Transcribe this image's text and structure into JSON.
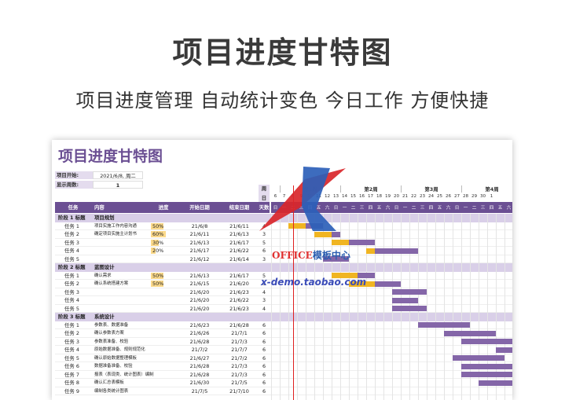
{
  "banner": {
    "title": "项目进度甘特图",
    "subtitle": "项目进度管理 自动统计变色 今日工作  方便快捷"
  },
  "sheet": {
    "title": "项目进度甘特图",
    "start_label": "项目开始:",
    "start_value": "2021/6/8, 周二",
    "weeks_label": "显示周数:",
    "weeks_value": "1",
    "corner_top": "周",
    "corner_bottom": "日",
    "columns": {
      "task": "任务",
      "content": "内容",
      "progress": "进度",
      "start": "开始日期",
      "end": "结束日期",
      "days": "天数"
    },
    "week_labels": [
      "第1周",
      "第2周",
      "第3周",
      "第4周"
    ],
    "day_numbers": [
      "6",
      "7",
      "8",
      "9",
      "10",
      "11",
      "12",
      "13",
      "14",
      "15",
      "16",
      "17",
      "18",
      "19",
      "20",
      "21",
      "22",
      "23",
      "24",
      "25",
      "26",
      "27",
      "28",
      "29",
      "30",
      "1"
    ],
    "weekday_labels": [
      "日",
      "一",
      "二",
      "三",
      "四",
      "五",
      "六",
      "日",
      "一",
      "二",
      "三",
      "四",
      "五",
      "六",
      "日",
      "一",
      "二",
      "三",
      "四",
      "五",
      "六",
      "日",
      "一",
      "二",
      "三",
      "四",
      "五",
      "六"
    ],
    "rows": [
      {
        "type": "phase",
        "task": "阶段 1 标题",
        "content": "项目规划"
      },
      {
        "type": "task",
        "task": "任务 1",
        "content": "项目实施工作内容沟通",
        "progress": "50%",
        "pct": 0.5,
        "start": "21/6/8",
        "end": "21/6/11",
        "days": "4",
        "s": 2,
        "e": 5
      },
      {
        "type": "task",
        "task": "任务 2",
        "content": "确定项目实施主计划书",
        "progress": "60%",
        "pct": 0.6,
        "start": "21/6/11",
        "end": "21/6/13",
        "days": "3",
        "s": 5,
        "e": 7
      },
      {
        "type": "task",
        "task": "任务 3",
        "content": "",
        "progress": "30%",
        "pct": 0.3,
        "start": "21/6/13",
        "end": "21/6/17",
        "days": "5",
        "s": 7,
        "e": 11
      },
      {
        "type": "task",
        "task": "任务 4",
        "content": "",
        "progress": "20%",
        "pct": 0.2,
        "start": "21/6/17",
        "end": "21/6/22",
        "days": "6",
        "s": 11,
        "e": 16
      },
      {
        "type": "task",
        "task": "任务 5",
        "content": "",
        "progress": "",
        "pct": 0,
        "start": "21/6/12",
        "end": "21/6/14",
        "days": "3",
        "s": 6,
        "e": 8
      },
      {
        "type": "phase",
        "task": "阶段 2 标题",
        "content": "蓝图设计"
      },
      {
        "type": "task",
        "task": "任务 1",
        "content": "确认需求",
        "progress": "50%",
        "pct": 0.5,
        "start": "21/6/13",
        "end": "21/6/17",
        "days": "5",
        "s": 7,
        "e": 11
      },
      {
        "type": "task",
        "task": "任务 2",
        "content": "确认系统搭建方案",
        "progress": "50%",
        "pct": 0.5,
        "start": "21/6/15",
        "end": "21/6/20",
        "days": "6",
        "s": 9,
        "e": 14
      },
      {
        "type": "task",
        "task": "任务 3",
        "content": "",
        "progress": "",
        "pct": 0,
        "start": "21/6/20",
        "end": "21/6/23",
        "days": "4",
        "s": 14,
        "e": 17
      },
      {
        "type": "task",
        "task": "任务 4",
        "content": "",
        "progress": "",
        "pct": 0,
        "start": "21/6/20",
        "end": "21/6/22",
        "days": "3",
        "s": 14,
        "e": 16
      },
      {
        "type": "task",
        "task": "任务 5",
        "content": "",
        "progress": "",
        "pct": 0,
        "start": "21/6/20",
        "end": "21/6/23",
        "days": "4",
        "s": 14,
        "e": 17
      },
      {
        "type": "phase",
        "task": "阶段 3 标题",
        "content": "系统设计"
      },
      {
        "type": "task",
        "task": "任务 1",
        "content": "参数表、数据准备",
        "progress": "",
        "pct": 0,
        "start": "21/6/23",
        "end": "21/6/28",
        "days": "6",
        "s": 17,
        "e": 22
      },
      {
        "type": "task",
        "task": "任务 2",
        "content": "确认参数表方案",
        "progress": "",
        "pct": 0,
        "start": "21/6/26",
        "end": "21/7/1",
        "days": "6",
        "s": 20,
        "e": 25
      },
      {
        "type": "task",
        "task": "任务 3",
        "content": "参数表准备、校验",
        "progress": "",
        "pct": 0,
        "start": "21/6/28",
        "end": "21/7/3",
        "days": "6",
        "s": 22,
        "e": 27
      },
      {
        "type": "task",
        "task": "任务 4",
        "content": "原始数据准备、规则规范化",
        "progress": "",
        "pct": 0,
        "start": "21/7/2",
        "end": "21/7/7",
        "days": "6",
        "s": 26,
        "e": 31
      },
      {
        "type": "task",
        "task": "任务 5",
        "content": "确认原始数据整理模板",
        "progress": "",
        "pct": 0,
        "start": "21/6/27",
        "end": "21/7/2",
        "days": "6",
        "s": 21,
        "e": 26
      },
      {
        "type": "task",
        "task": "任务 6",
        "content": "数据准备准备、校验",
        "progress": "",
        "pct": 0,
        "start": "21/6/28",
        "end": "21/7/3",
        "days": "6",
        "s": 22,
        "e": 27
      },
      {
        "type": "task",
        "task": "任务 7",
        "content": "报表（表现类、统计图表）编制",
        "progress": "",
        "pct": 0,
        "start": "21/6/28",
        "end": "21/7/3",
        "days": "6",
        "s": 22,
        "e": 27
      },
      {
        "type": "task",
        "task": "任务 8",
        "content": "确认汇总表模板",
        "progress": "",
        "pct": 0,
        "start": "21/6/30",
        "end": "21/7/5",
        "days": "6",
        "s": 24,
        "e": 29
      },
      {
        "type": "task",
        "task": "任务 9",
        "content": "编制各类统计图表",
        "progress": "",
        "pct": 0,
        "start": "21/7/5",
        "end": "21/7/10",
        "days": "6",
        "s": 29,
        "e": 34
      }
    ]
  },
  "watermark": {
    "office": "OFFICE",
    "office_cn": "模板中心",
    "url": "x-demo.taobao.com"
  },
  "colors": {
    "header": "#6b4f93",
    "phase": "#d9cfe8",
    "bar_plan": "#8466a8",
    "bar_done": "#f0b522",
    "progress_fill": "#fbd98a",
    "today_line": "#e02020"
  }
}
